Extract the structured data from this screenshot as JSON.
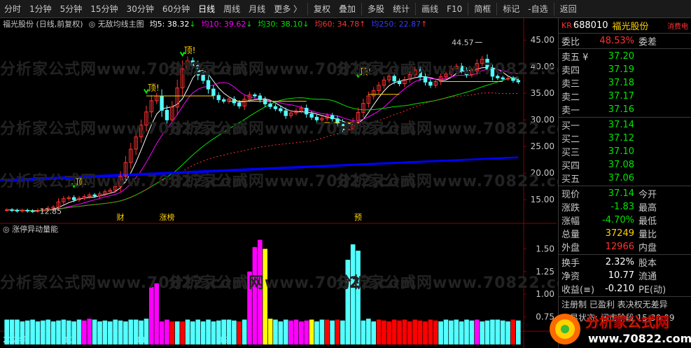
{
  "toolbar": {
    "periods": [
      "分时",
      "1分钟",
      "5分钟",
      "15分钟",
      "30分钟",
      "60分钟",
      "日线",
      "周线",
      "月线"
    ],
    "more": "更多 〉",
    "active_period": "日线",
    "tools": [
      "复权",
      "叠加",
      "多股",
      "统计",
      "画线",
      "F10",
      "简框",
      "标记"
    ],
    "select": "-自选",
    "back": "返回"
  },
  "main_header": {
    "stock": "福光股份 (日线,前复权)",
    "indicator": "无敌均线主图",
    "ma5_label": "均5:",
    "ma5_value": "38.32",
    "ma10_label": "均10:",
    "ma10_value": "39.62",
    "ma30_label": "均30:",
    "ma30_value": "38.10",
    "ma60_label": "均60:",
    "ma60_value": "34.78",
    "ma250_label": "均250:",
    "ma250_value": "22.87"
  },
  "sub_header": {
    "indicator": "涨停异动量能"
  },
  "chart_data": [
    {
      "type": "candlestick",
      "title": "",
      "x_labels": [
        "2024年",
        "10",
        "11",
        "12",
        "1",
        "2",
        "3"
      ],
      "y_ticks": [
        15.0,
        20.0,
        25.0,
        30.0,
        35.0,
        40.0,
        45.0
      ],
      "ylim": [
        12,
        47
      ],
      "max_label": "44.57",
      "min_label": "12.85",
      "markers": [
        "顶!",
        "顶!",
        "顶!",
        "顶!"
      ],
      "tags": [
        "财",
        "涨榜",
        "预"
      ],
      "close": [
        13.1,
        13.0,
        12.9,
        13.0,
        12.9,
        12.85,
        13.0,
        13.1,
        13.4,
        13.6,
        14.6,
        15.2,
        15.4,
        15.0,
        15.3,
        15.6,
        15.9,
        15.7,
        16.1,
        16.5,
        16.8,
        17.5,
        19.4,
        22.0,
        24.5,
        26.8,
        29.0,
        31.5,
        33.6,
        34.5,
        31.8,
        30.0,
        32.4,
        36.0,
        39.6,
        41.1,
        40.2,
        38.4,
        37.4,
        35.8,
        34.6,
        33.8,
        33.5,
        33.9,
        33.2,
        32.6,
        33.9,
        34.7,
        34.5,
        33.8,
        33.0,
        32.5,
        32.1,
        31.7,
        30.8,
        31.3,
        31.7,
        32.2,
        31.1,
        30.5,
        30.0,
        30.3,
        30.8,
        30.2,
        29.4,
        28.1,
        28.3,
        29.6,
        31.4,
        33.1,
        34.5,
        35.5,
        36.5,
        37.5,
        38.2,
        37.3,
        36.8,
        37.6,
        38.5,
        39.4,
        38.1,
        37.1,
        36.5,
        37.2,
        38.1,
        38.6,
        39.6,
        40.1,
        39.3,
        38.5,
        39.2,
        40.6,
        41.4,
        39.6,
        38.2,
        37.9,
        37.7,
        37.8,
        37.4,
        37.14
      ],
      "ma_lines": [
        "MA5",
        "MA10",
        "MA30",
        "MA60",
        "MA250"
      ],
      "ma_colors": [
        "#ffffff",
        "#ff00ff",
        "#00e600",
        "#ff3232",
        "#0000ff"
      ]
    },
    {
      "type": "bar",
      "title": "",
      "y_ticks": [
        0.75,
        1.0,
        1.25,
        1.5
      ],
      "ylim": [
        0.6,
        1.65
      ],
      "values": [
        0.72,
        0.72,
        0.72,
        0.7,
        0.71,
        0.72,
        0.7,
        0.71,
        0.72,
        0.7,
        0.71,
        0.72,
        0.71,
        0.7,
        0.72,
        0.71,
        0.73,
        0.72,
        0.7,
        0.71,
        0.7,
        0.72,
        0.71,
        0.7,
        0.72,
        0.72,
        0.71,
        0.73,
        1.08,
        1.12,
        0.7,
        0.72,
        0.7,
        0.7,
        0.7,
        0.72,
        0.7,
        0.72,
        0.7,
        0.72,
        0.7,
        0.71,
        0.72,
        0.72,
        0.71,
        0.7,
        0.72,
        1.25,
        1.52,
        1.6,
        1.5,
        0.73,
        0.72,
        0.7,
        0.72,
        0.71,
        0.72,
        0.7,
        0.71,
        0.72,
        0.7,
        0.72,
        0.72,
        0.71,
        0.72,
        0.71,
        1.38,
        1.55,
        1.48,
        0.71,
        0.73,
        0.7,
        0.72,
        0.71,
        0.7,
        0.72,
        0.71,
        0.72,
        0.7,
        0.72,
        0.71,
        0.7,
        0.72,
        0.71,
        0.7,
        0.72,
        0.71,
        0.72,
        0.7,
        0.72,
        0.71,
        0.72,
        0.7,
        0.71,
        0.72,
        0.72,
        0.71,
        0.7,
        0.72,
        0.71
      ],
      "colors": [
        "cyan",
        "cyan",
        "cyan",
        "cyan",
        "cyan",
        "cyan",
        "cyan",
        "cyan",
        "cyan",
        "cyan",
        "cyan",
        "cyan",
        "cyan",
        "cyan",
        "cyan",
        "magenta",
        "magenta",
        "cyan",
        "cyan",
        "cyan",
        "cyan",
        "cyan",
        "cyan",
        "cyan",
        "cyan",
        "cyan",
        "cyan",
        "cyan",
        "magenta",
        "magenta",
        "magenta",
        "magenta",
        "red",
        "cyan",
        "red",
        "cyan",
        "cyan",
        "cyan",
        "cyan",
        "cyan",
        "cyan",
        "cyan",
        "cyan",
        "cyan",
        "cyan",
        "red",
        "cyan",
        "magenta",
        "magenta",
        "magenta",
        "yellow",
        "yellow",
        "cyan",
        "cyan",
        "cyan",
        "magenta",
        "magenta",
        "magenta",
        "magenta",
        "yellow",
        "cyan",
        "cyan",
        "red",
        "cyan",
        "red",
        "cyan",
        "cyan",
        "cyan",
        "cyan",
        "cyan",
        "cyan",
        "cyan",
        "red",
        "red",
        "red",
        "red",
        "red",
        "red",
        "red",
        "red",
        "red",
        "red",
        "red",
        "red",
        "cyan",
        "cyan",
        "cyan",
        "cyan",
        "cyan",
        "cyan",
        "cyan",
        "magenta",
        "cyan",
        "cyan",
        "cyan",
        "cyan",
        "cyan",
        "cyan",
        "red",
        "cyan"
      ]
    }
  ],
  "right_panel": {
    "code_prefix": "KR",
    "code": "688010",
    "name": "福光股份",
    "badge": "消费电",
    "webi_label": "委比",
    "webi_value": "48.53%",
    "weicha_label": "委差",
    "asks": [
      {
        "label": "卖五 ¥",
        "price": "37.20"
      },
      {
        "label": "卖四",
        "price": "37.19"
      },
      {
        "label": "卖三",
        "price": "37.18"
      },
      {
        "label": "卖二",
        "price": "37.17"
      },
      {
        "label": "卖一",
        "price": "37.16"
      }
    ],
    "bids": [
      {
        "label": "买一",
        "price": "37.14"
      },
      {
        "label": "买二",
        "price": "37.12"
      },
      {
        "label": "买三",
        "price": "37.10"
      },
      {
        "label": "买四",
        "price": "37.08"
      },
      {
        "label": "买五",
        "price": "37.06"
      }
    ],
    "stats": [
      {
        "l1": "现价",
        "v1": "37.14",
        "c1": "green",
        "l2": "今开"
      },
      {
        "l1": "涨跌",
        "v1": "-1.83",
        "c1": "green",
        "l2": "最高"
      },
      {
        "l1": "涨幅",
        "v1": "-4.70%",
        "c1": "green",
        "l2": "最低"
      },
      {
        "l1": "总量",
        "v1": "37249",
        "c1": "yellow",
        "l2": "量比"
      },
      {
        "l1": "外盘",
        "v1": "12966",
        "c1": "red",
        "l2": "内盘"
      }
    ],
    "stats2": [
      {
        "l1": "换手",
        "v1": "2.32%",
        "l2": "股本"
      },
      {
        "l1": "净资",
        "v1": "10.77",
        "l2": "流通"
      },
      {
        "l1": "收益(≡)",
        "v1": "-0.210",
        "l2": "PE(动)"
      }
    ],
    "flags": "注册制  已盈利  表决权无差异",
    "status": "交易状态: 闭市阶段 15:30:09"
  },
  "watermark": "分析家公式网www.70822.com",
  "logo": {
    "text": "分析家公式网",
    "url": "www.70822.com"
  }
}
